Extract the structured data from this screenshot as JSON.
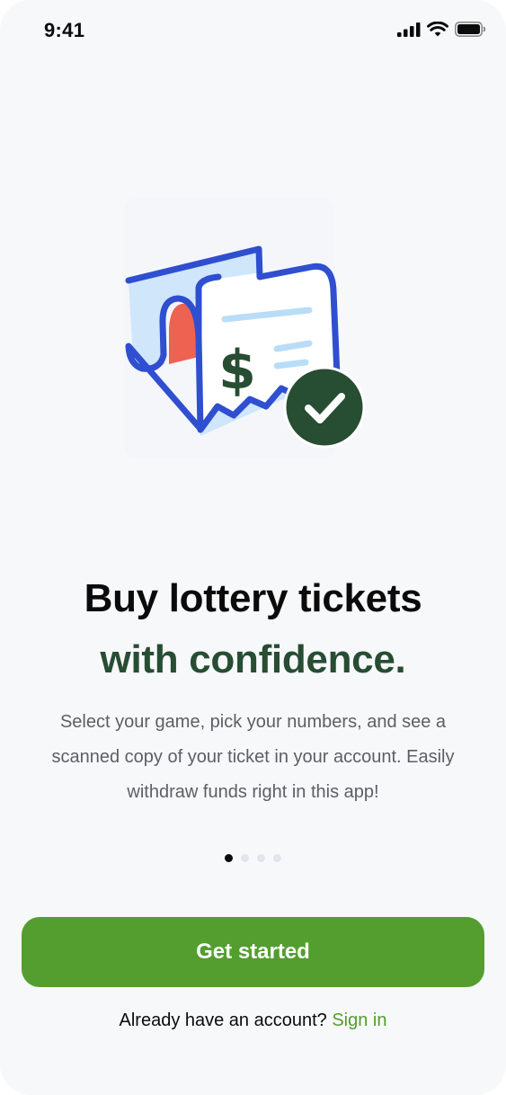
{
  "status_bar": {
    "time": "9:41",
    "icons": [
      "cellular-signal-icon",
      "wifi-icon",
      "battery-icon"
    ]
  },
  "illustration": {
    "icon": "receipt-check-icon",
    "currency_symbol": "$",
    "colors": {
      "outline": "#2f4fd0",
      "paper_fill": "#cfe6fb",
      "accent_red": "#ee6252",
      "dollar": "#274d33",
      "badge": "#274d33",
      "lines": "#b9ddf7"
    }
  },
  "onboarding": {
    "headline": "Buy lottery tickets",
    "headline_accent": "with confidence.",
    "body": "Select your game, pick your numbers, and see a scanned copy of your ticket in your account. Easily withdraw funds right in this app!",
    "page_count": 4,
    "active_page": 1
  },
  "actions": {
    "primary_label": "Get started",
    "signin_prompt": "Already have an account?",
    "signin_link": "Sign in"
  },
  "colors": {
    "brand_green": "#539e2e",
    "dark_green": "#274d33",
    "background": "#f7f8fa"
  }
}
